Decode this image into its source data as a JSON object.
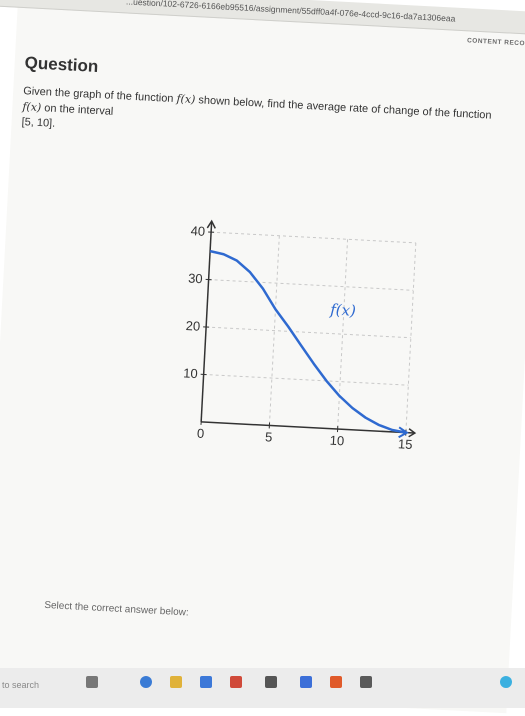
{
  "browser": {
    "url": "...uestion/102-6726-6166eb95516/assignment/55dff0a4f-076e-4ccd-9c16-da7a1306eaa",
    "content_record": "CONTENT RECORD"
  },
  "question": {
    "title": "Question",
    "prompt_part1": "Given the graph of the function",
    "fx1": "f(x)",
    "prompt_part2": "shown below, find the average rate of change of the function",
    "fx2": "f(x)",
    "prompt_part3": "on the interval",
    "interval": "[5, 10]."
  },
  "chart_data": {
    "type": "line",
    "curve_label": "f(x)",
    "x_ticks": [
      "0",
      "5",
      "10",
      "15"
    ],
    "y_ticks": [
      "10",
      "20",
      "30",
      "40"
    ],
    "xlim": [
      0,
      15
    ],
    "ylim": [
      0,
      40
    ],
    "series": [
      {
        "x": [
          0,
          1,
          2,
          3,
          4,
          5,
          6,
          7,
          8,
          9,
          10,
          11,
          12,
          13,
          14,
          15
        ],
        "y": [
          36,
          35.5,
          34.3,
          32,
          28.7,
          24.5,
          21,
          17.2,
          13.5,
          10,
          7,
          4.6,
          2.7,
          1.3,
          0.4,
          0
        ]
      }
    ],
    "line_color": "#2f6ad0",
    "grid": true
  },
  "answer": {
    "select_label": "Select the correct answer below:"
  },
  "taskbar": {
    "search_text": "to search"
  }
}
